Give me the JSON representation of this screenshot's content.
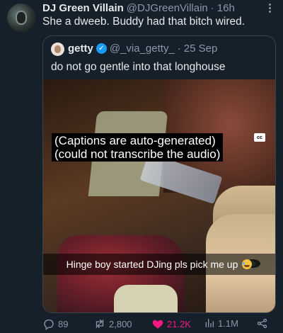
{
  "tweet": {
    "author_name": "DJ Green Villain",
    "author_handle": "@DJGreenVillain",
    "separator": "·",
    "time": "16h",
    "text": "She a dweeb. Buddy had that bitch wired."
  },
  "quote": {
    "author_name": "getty",
    "author_handle": "@_via_getty_",
    "separator": "·",
    "date": "25 Sep",
    "text": "do not go gentle into that longhouse",
    "verified": true,
    "video": {
      "captions_line1": "(Captions are auto-generated)",
      "captions_line2": "(could not transcribe the audio)",
      "cc_badge": "cc",
      "overlay_text": "Hinge boy started DJing pls pick me up",
      "overlay_emoji": "sweat-smile-emoji",
      "volume_icon": "volume-icon"
    }
  },
  "actions": {
    "replies": "89",
    "reposts": "2,800",
    "likes": "21.2K",
    "views": "1.1M",
    "like_color": "#f91880",
    "muted_color": "#8b98a5"
  },
  "colors": {
    "background": "#15202b",
    "border": "#38444d",
    "verified": "#1d9bf0"
  }
}
